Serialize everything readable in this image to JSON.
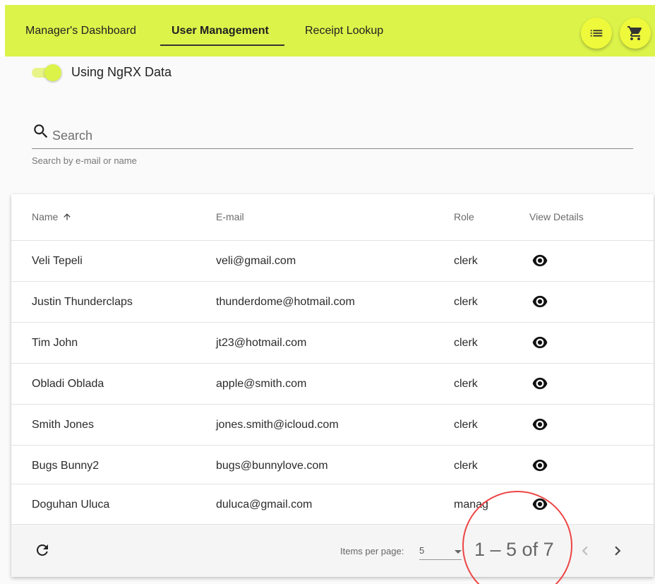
{
  "nav": {
    "tabs": [
      {
        "label": "Manager's Dashboard"
      },
      {
        "label": "User Management"
      },
      {
        "label": "Receipt Lookup"
      }
    ]
  },
  "header": {
    "list_icon": "list-icon",
    "cart_icon": "shopping-cart-icon"
  },
  "toggle": {
    "label": "Using NgRX Data",
    "on": true
  },
  "search": {
    "placeholder": "Search",
    "hint": "Search by e-mail or name",
    "value": ""
  },
  "table": {
    "columns": [
      {
        "label": "Name",
        "sort": "ascending"
      },
      {
        "label": "E-mail"
      },
      {
        "label": "Role"
      },
      {
        "label": "View Details"
      }
    ],
    "rows": [
      {
        "name": "Veli Tepeli",
        "email": "veli@gmail.com",
        "role": "clerk"
      },
      {
        "name": "Justin Thunderclaps",
        "email": "thunderdome@hotmail.com",
        "role": "clerk"
      },
      {
        "name": "Tim John",
        "email": "jt23@hotmail.com",
        "role": "clerk"
      },
      {
        "name": "Obladi Oblada",
        "email": "apple@smith.com",
        "role": "clerk"
      },
      {
        "name": "Smith Jones",
        "email": "jones.smith@icloud.com",
        "role": "clerk"
      },
      {
        "name": "Bugs Bunny2",
        "email": "bugs@bunnylove.com",
        "role": "clerk"
      },
      {
        "name": "Doguhan Uluca",
        "email": "duluca@gmail.com",
        "role": "manag"
      }
    ]
  },
  "paginator": {
    "items_per_page_label": "Items per page:",
    "items_per_page_value": "5",
    "range_label": "1 – 5 of 7"
  },
  "colors": {
    "toolbar": "#dcf34a",
    "accent": "#dcf34a",
    "highlight": "#ee4444"
  }
}
